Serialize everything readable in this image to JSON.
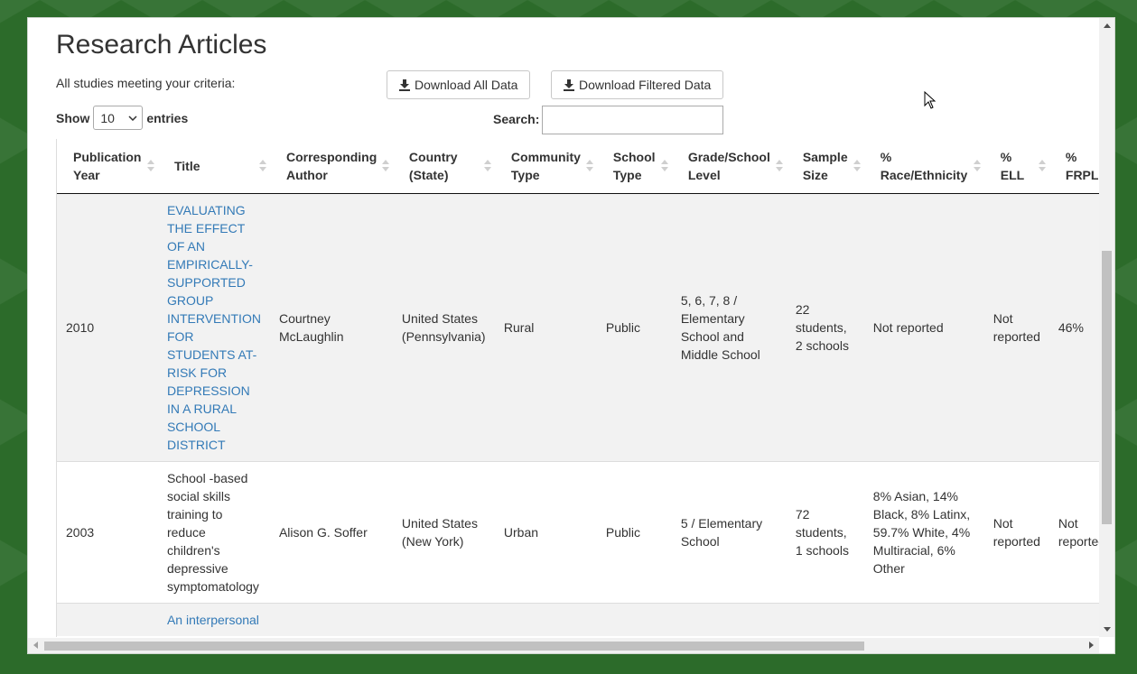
{
  "page": {
    "title": "Research Articles",
    "criteria_label": "All studies meeting your criteria:",
    "download_all_label": "Download All Data",
    "download_filtered_label": "Download Filtered Data",
    "show_label": "Show",
    "entries_value": "10",
    "entries_label": "entries",
    "search_label": "Search:",
    "search_value": ""
  },
  "table": {
    "columns": [
      {
        "line1": "Publication",
        "line2": "Year"
      },
      {
        "line1": "Title",
        "line2": ""
      },
      {
        "line1": "Corresponding",
        "line2": "Author"
      },
      {
        "line1": "Country",
        "line2": "(State)"
      },
      {
        "line1": "Community",
        "line2": "Type"
      },
      {
        "line1": "School",
        "line2": "Type"
      },
      {
        "line1": "Grade/School",
        "line2": "Level"
      },
      {
        "line1": "Sample",
        "line2": "Size"
      },
      {
        "line1": "%",
        "line2": "Race/Ethnicity"
      },
      {
        "line1": "%",
        "line2": "ELL"
      },
      {
        "line1": "%",
        "line2": "FRPL"
      }
    ],
    "rows": [
      {
        "year": "2010",
        "title": "EVALUATING THE EFFECT OF AN EMPIRICALLY-SUPPORTED GROUP INTERVENTION FOR STUDENTS AT-RISK FOR DEPRESSION IN A RURAL SCHOOL DISTRICT",
        "title_is_link": true,
        "author": "Courtney McLaughlin",
        "country": "United States (Pennsylvania)",
        "community": "Rural",
        "school_type": "Public",
        "grade": "5, 6, 7, 8 / Elementary School and Middle School",
        "sample": "22 students, 2 schools",
        "race": "Not reported",
        "ell": "Not reported",
        "frpl": "46%"
      },
      {
        "year": "2003",
        "title": "School -based social skills training to reduce children's depressive symptomatology",
        "title_is_link": false,
        "author": "Alison G. Soffer",
        "country": "United States (New York)",
        "community": "Urban",
        "school_type": "Public",
        "grade": "5 / Elementary School",
        "sample": "72 students, 1 schools",
        "race": "8% Asian, 14% Black, 8% Latinx, 59.7% White, 4% Multiracial, 6% Other",
        "ell": "Not reported",
        "frpl": "Not reported"
      },
      {
        "year": "",
        "title": "An interpersonal",
        "title_is_link": true,
        "author": "",
        "country": "",
        "community": "",
        "school_type": "",
        "grade": "",
        "sample": "",
        "race": "",
        "ell": "",
        "frpl": ""
      }
    ]
  },
  "colors": {
    "background_green": "#2c6b2a",
    "link_blue": "#337ab7",
    "text": "#333333"
  },
  "icons": [
    "download-icon",
    "sort-icon",
    "chevron-down-icon",
    "mouse-cursor-icon"
  ]
}
